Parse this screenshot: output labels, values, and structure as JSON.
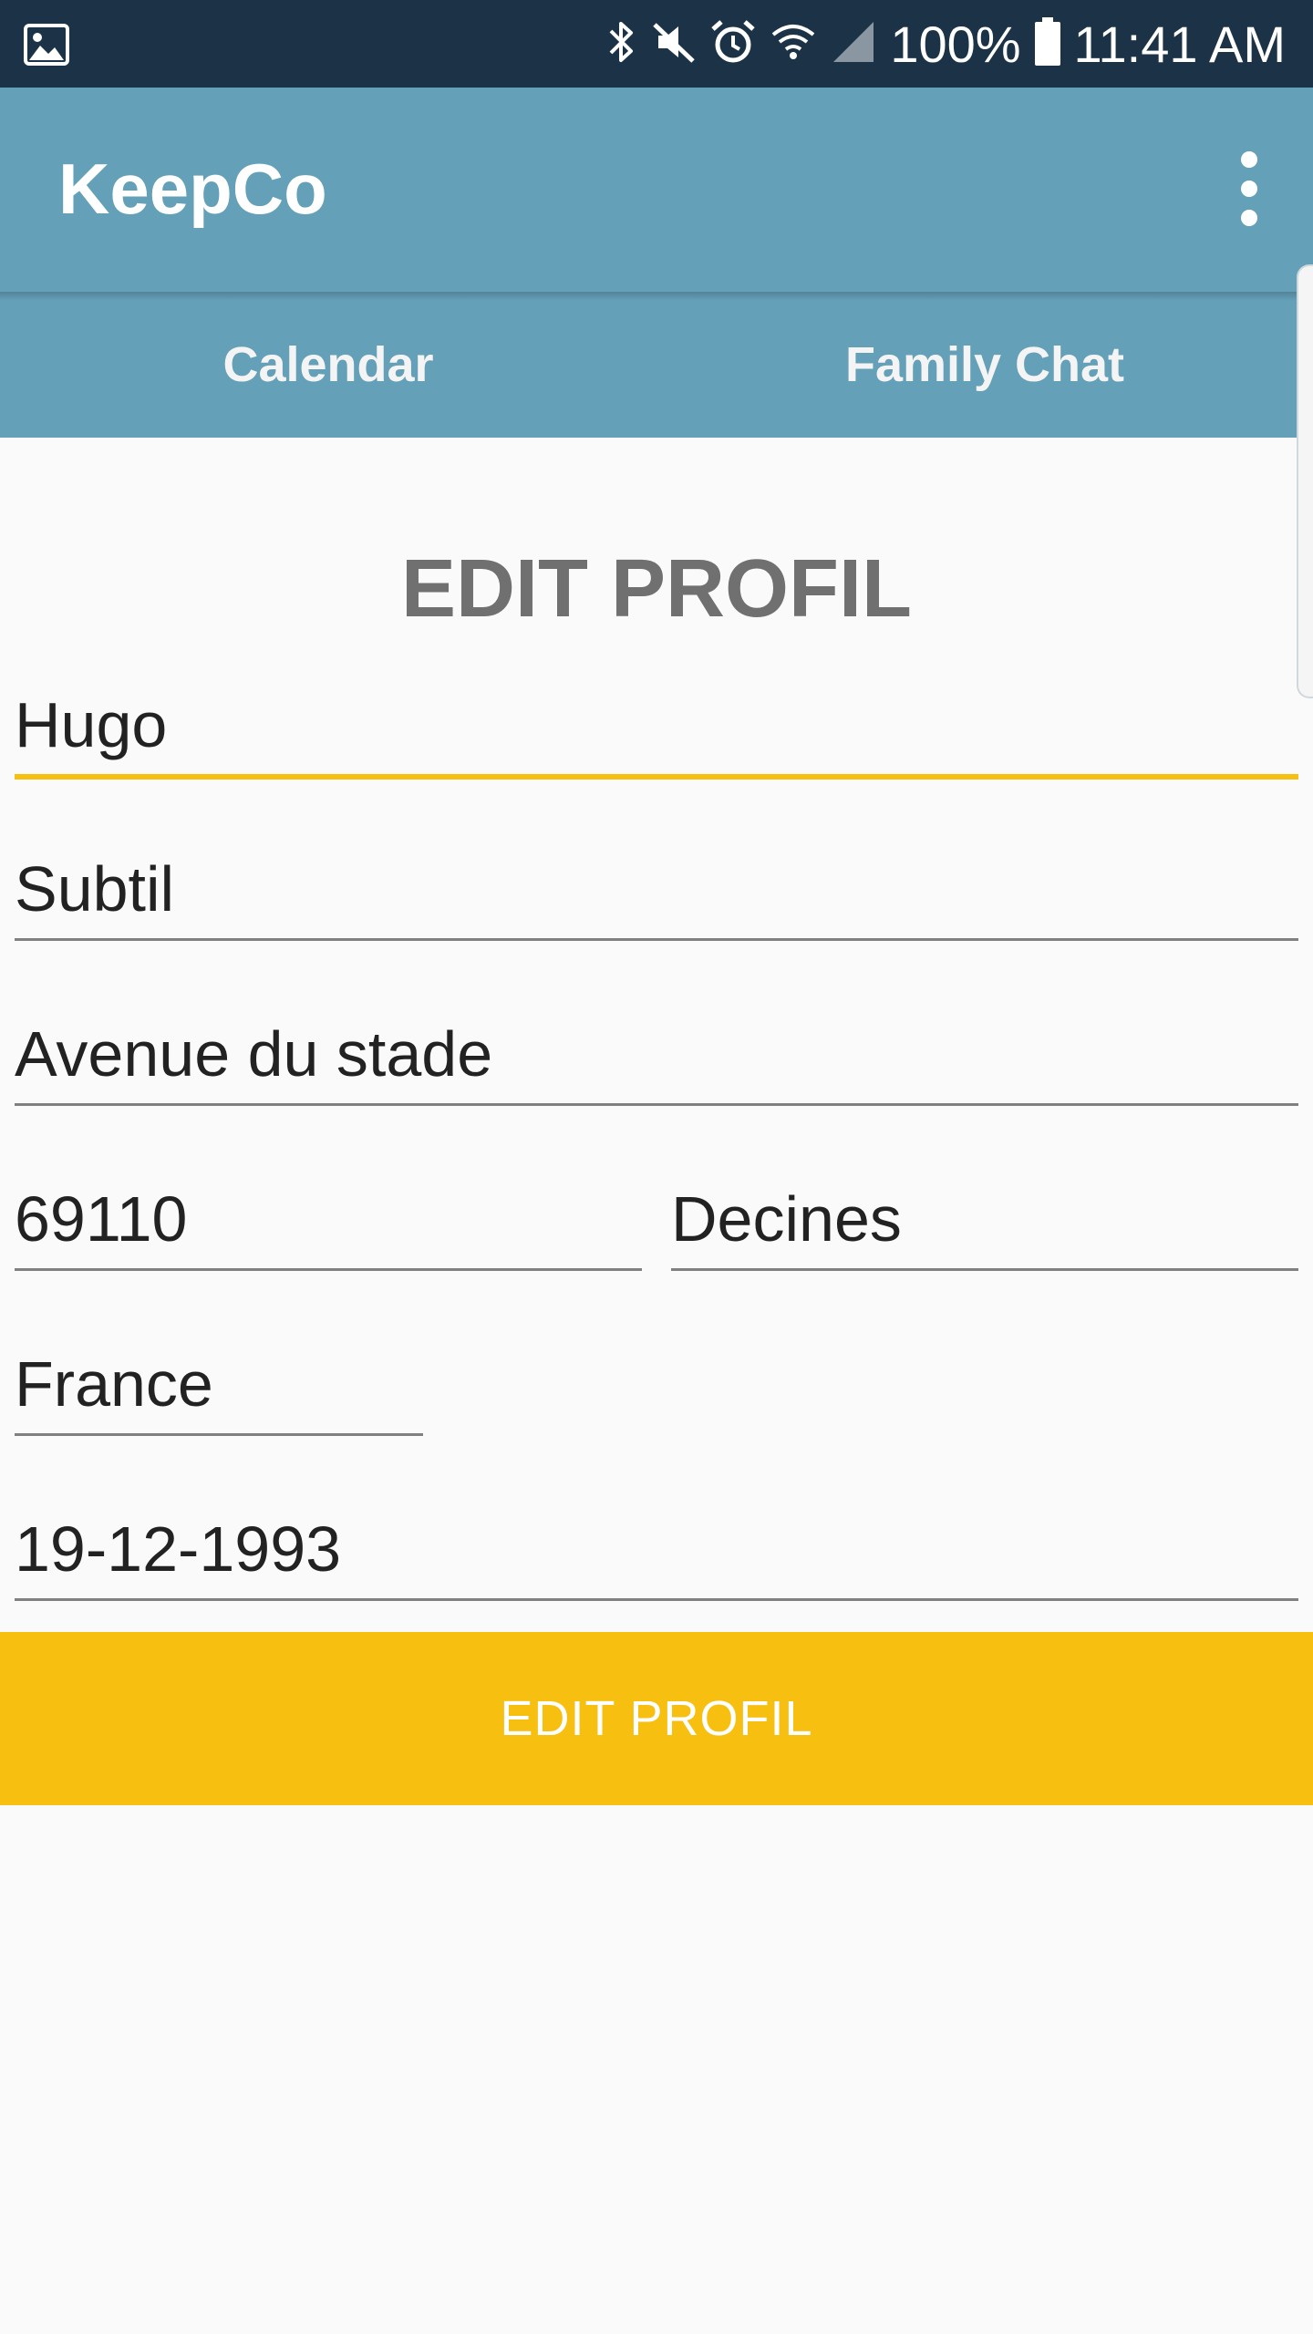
{
  "status_bar": {
    "battery": "100%",
    "time": "11:41 AM",
    "icons": [
      "gallery-icon",
      "bluetooth-icon",
      "mute-icon",
      "alarm-icon",
      "wifi-icon",
      "signal-icon",
      "battery-icon"
    ]
  },
  "app_bar": {
    "title": "KeepCo",
    "menu_icon": "more-vert-icon"
  },
  "tabs": [
    {
      "label": "Calendar"
    },
    {
      "label": "Family Chat"
    }
  ],
  "page": {
    "heading": "EDIT PROFIL"
  },
  "form": {
    "first_name": "Hugo",
    "last_name": "Subtil",
    "street": "Avenue du stade",
    "postal_code": "69110",
    "city": "Decines",
    "country": "France",
    "birth_date": "19-12-1993"
  },
  "submit": {
    "label": "EDIT PROFIL"
  },
  "colors": {
    "status_bar": "#1c3347",
    "app_bar": "#65a0b9",
    "accent": "#f7c010",
    "heading": "#707070",
    "background": "#fafafa"
  }
}
